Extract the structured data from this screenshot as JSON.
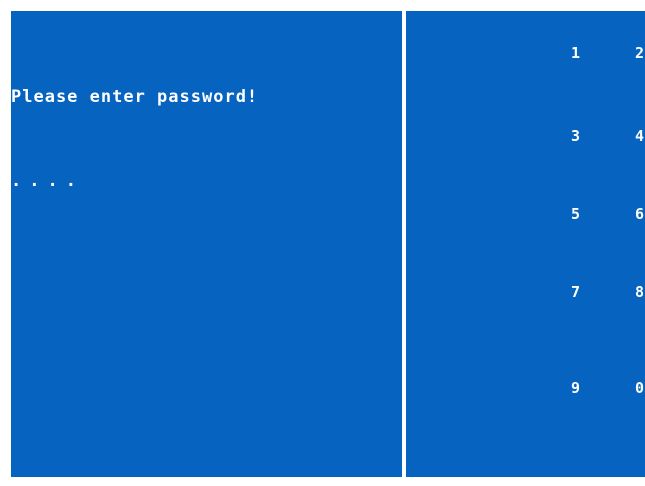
{
  "colors": {
    "panel_background": "#0663bf",
    "divider": "#ffffff",
    "text": "#ffffff"
  },
  "left_panel": {
    "prompt": "Please enter password!",
    "masked_input": "...."
  },
  "keypad": {
    "keys": [
      "1",
      "2",
      "3",
      "4",
      "5",
      "6",
      "7",
      "8",
      "9",
      "0"
    ]
  }
}
